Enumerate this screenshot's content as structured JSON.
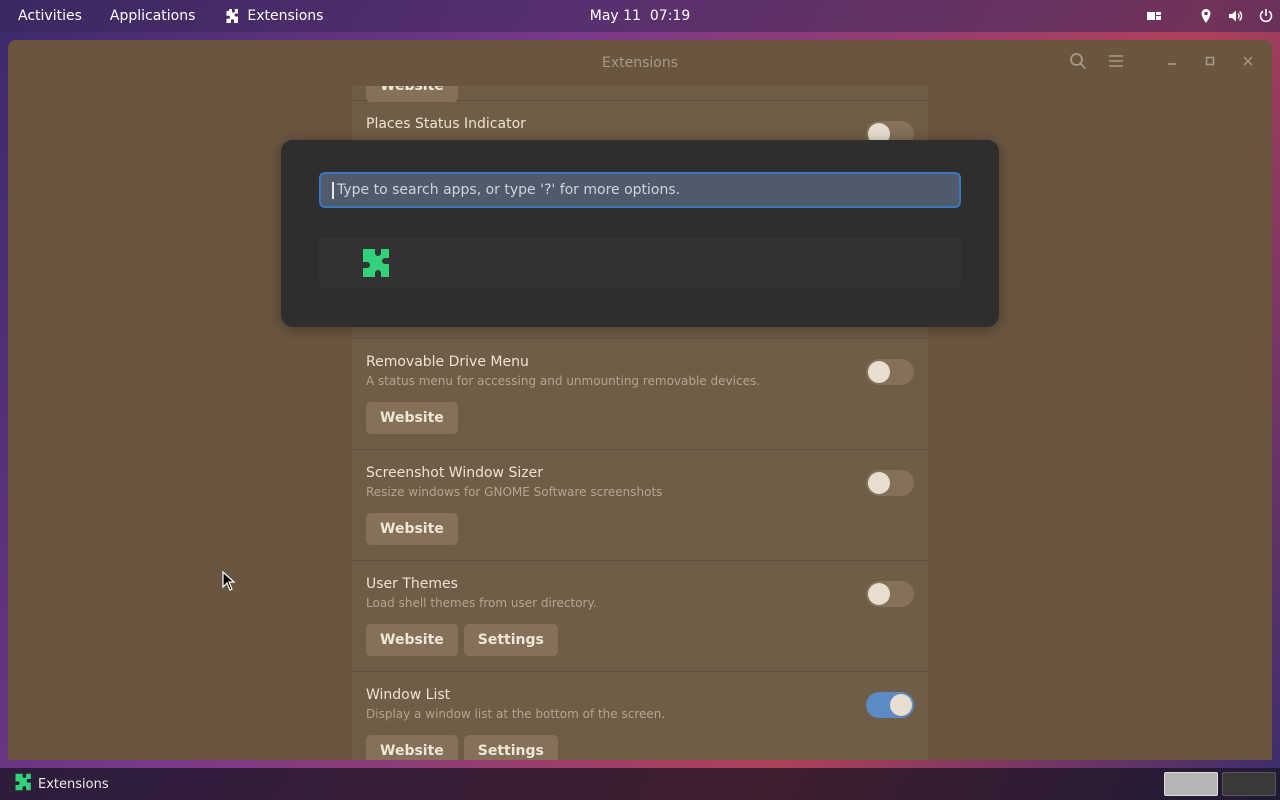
{
  "topbar": {
    "activities": "Activities",
    "applications": "Applications",
    "app_name": "Extensions",
    "date": "May 11",
    "time": "07:19",
    "icons": [
      "window-layout-icon",
      "location-icon",
      "volume-icon",
      "power-icon"
    ]
  },
  "window": {
    "title": "Extensions",
    "header_icons": [
      "search-icon",
      "menu-icon",
      "minimize-icon",
      "maximize-icon",
      "close-icon"
    ]
  },
  "extensions": {
    "partial_top": {
      "button": "Website"
    },
    "partial_second": {
      "name": "Places Status Indicator"
    },
    "items": [
      {
        "name": "Removable Drive Menu",
        "description": "A status menu for accessing and unmounting removable devices.",
        "buttons": [
          "Website"
        ],
        "enabled": false
      },
      {
        "name": "Screenshot Window Sizer",
        "description": "Resize windows for GNOME Software screenshots",
        "buttons": [
          "Website"
        ],
        "enabled": false
      },
      {
        "name": "User Themes",
        "description": "Load shell themes from user directory.",
        "buttons": [
          "Website",
          "Settings"
        ],
        "enabled": false
      },
      {
        "name": "Window List",
        "description": "Display a window list at the bottom of the screen.",
        "buttons": [
          "Website",
          "Settings"
        ],
        "enabled": true
      }
    ]
  },
  "run_dialog": {
    "placeholder": "Type to search apps, or type '?' for more options.",
    "result_icon": "puzzle-icon"
  },
  "taskbar": {
    "app_label": "Extensions"
  },
  "colors": {
    "accent": "#3b75c2",
    "toggle_on": "#5b8ac4",
    "puzzle_green": "#33d17a"
  }
}
